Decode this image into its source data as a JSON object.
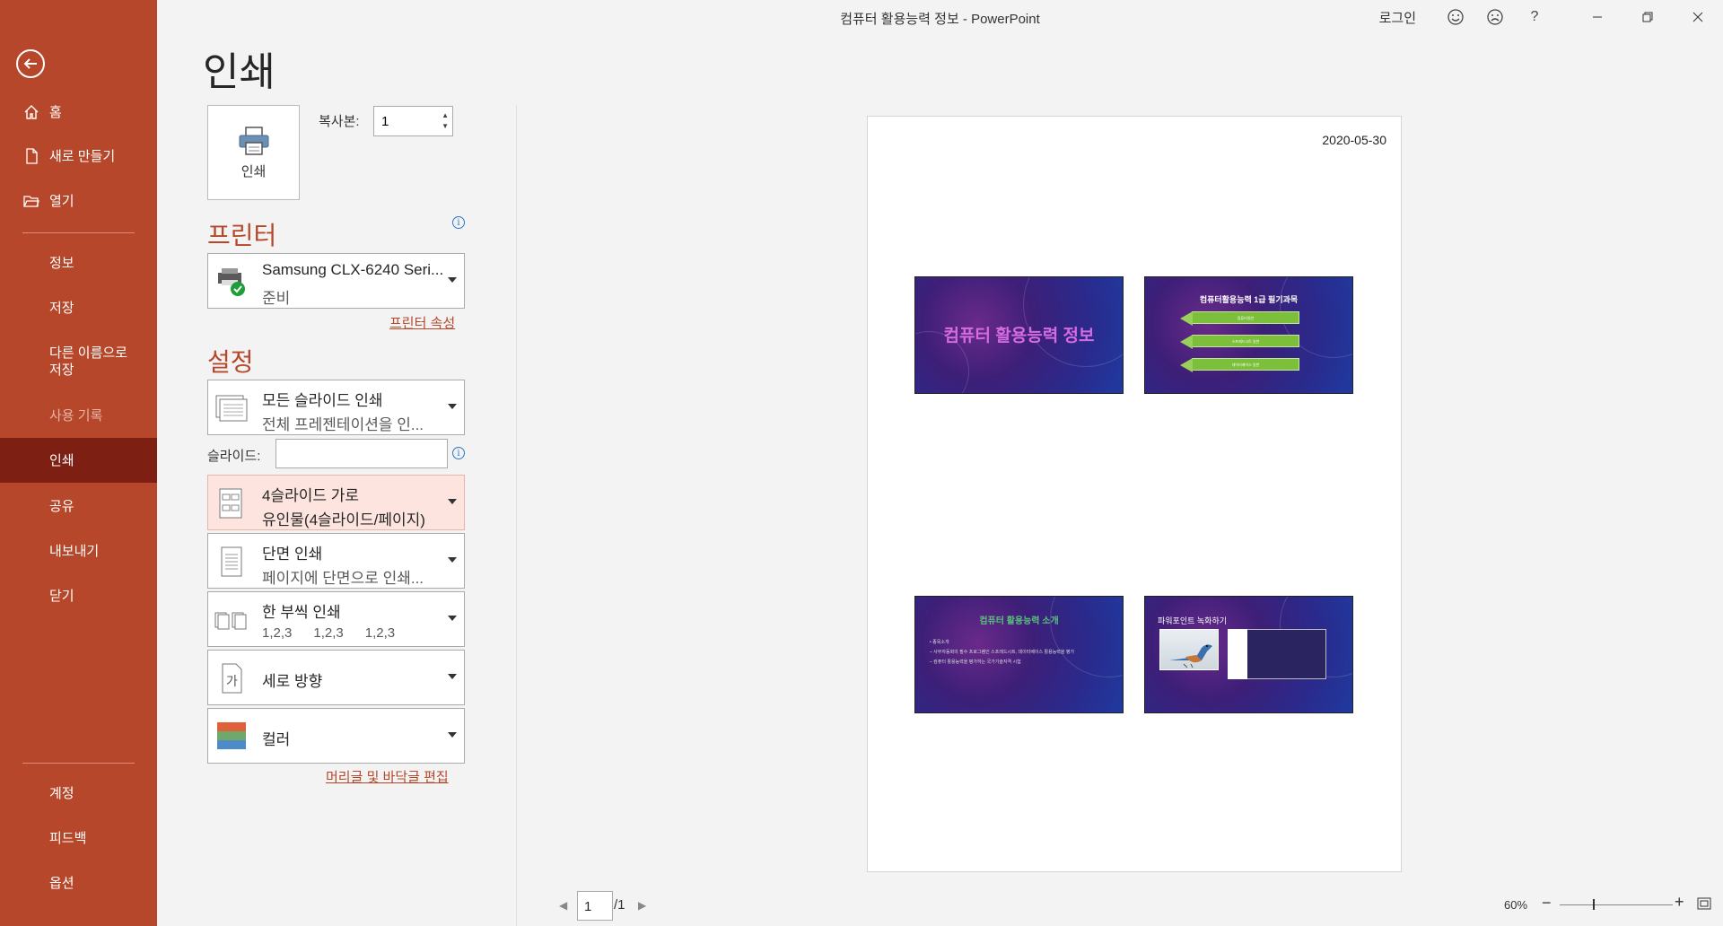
{
  "window": {
    "title": "컴퓨터 활용능력 정보  -  PowerPoint",
    "login": "로그인",
    "help": "?"
  },
  "sidebar": {
    "items": [
      {
        "label": "홈"
      },
      {
        "label": "새로 만들기"
      },
      {
        "label": "열기"
      },
      {
        "label": "정보"
      },
      {
        "label": "저장"
      },
      {
        "label": "다른 이름으로\n저장"
      },
      {
        "label": "사용 기록"
      },
      {
        "label": "인쇄"
      },
      {
        "label": "공유"
      },
      {
        "label": "내보내기"
      },
      {
        "label": "닫기"
      },
      {
        "label": "계정"
      },
      {
        "label": "피드백"
      },
      {
        "label": "옵션"
      }
    ]
  },
  "print": {
    "page_title": "인쇄",
    "button_label": "인쇄",
    "copies_label": "복사본:",
    "copies_value": "1"
  },
  "printer": {
    "heading": "프린터",
    "name": "Samsung CLX-6240 Seri...",
    "status": "준비",
    "properties_link": "프린터 속성"
  },
  "settings": {
    "heading": "설정",
    "slides_range": {
      "main": "모든 슬라이드 인쇄",
      "sub": "전체 프레젠테이션을 인..."
    },
    "slides_label": "슬라이드:",
    "slides_value": "",
    "layout": {
      "main": "4슬라이드 가로",
      "sub": "유인물(4슬라이드/페이지)"
    },
    "sides": {
      "main": "단면 인쇄",
      "sub": "페이지에 단면으로 인쇄..."
    },
    "collate": {
      "main": "한 부씩 인쇄",
      "sub": [
        "1,2,3",
        "1,2,3",
        "1,2,3"
      ]
    },
    "orientation": {
      "main": "세로 방향"
    },
    "color": {
      "main": "컬러"
    },
    "header_footer_link": "머리글 및 바닥글 편집"
  },
  "preview": {
    "date": "2020-05-30",
    "slides": [
      {
        "title": "컴퓨터 활용능력 정보"
      },
      {
        "title": "컴퓨터활용능력 1급 필기과목",
        "bars": [
          "컴퓨터일반",
          "스프레드시트 일반",
          "데이터베이스 일반"
        ]
      },
      {
        "title": "컴퓨터 활용능력 소개",
        "bullets": [
          "• 종목소개",
          "– 사무자동화의 필수 프로그램인 스프레드시트, 데이터베이스 활용능력을 평가",
          "– 컴퓨터 활용능력을 평가하는 국가기술자격 시험"
        ]
      },
      {
        "title": "파워포인트 녹화하기"
      }
    ],
    "page_current": "1",
    "page_total": "/1",
    "zoom": "60%"
  },
  "colors": {
    "accent": "#b7472a",
    "sidebar_active": "#7e1f13"
  }
}
